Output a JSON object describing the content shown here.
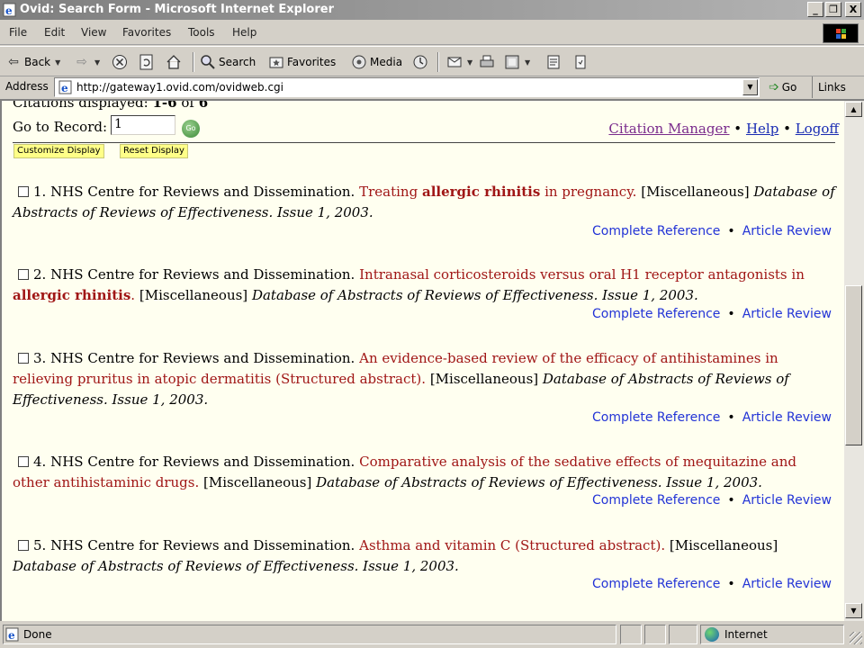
{
  "window": {
    "title": "Ovid: Search Form - Microsoft Internet Explorer",
    "controls": [
      "_",
      "❐",
      "X"
    ]
  },
  "menu": [
    "File",
    "Edit",
    "View",
    "Favorites",
    "Tools",
    "Help"
  ],
  "toolbar": {
    "back": "Back",
    "search": "Search",
    "favorites": "Favorites",
    "media": "Media"
  },
  "address": {
    "label": "Address",
    "url": "http://gateway1.ovid.com/ovidweb.cgi",
    "go": "Go",
    "links": "Links"
  },
  "page": {
    "citations_label": "Citations displayed:",
    "citations_range": "1-6",
    "citations_of": "of",
    "citations_total": "6",
    "goto_label": "Go to Record:",
    "goto_value": "1",
    "go_button": "Go",
    "citation_manager": "Citation Manager",
    "help": "Help",
    "logoff": "Logoff",
    "bullet": "•",
    "customize_display": "Customize Display",
    "reset_display": "Reset Display",
    "complete_reference": "Complete Reference",
    "article_review": "Article Review",
    "citations": [
      {
        "number": "1.",
        "author": "NHS Centre for Reviews and Dissemination.",
        "title_pre": "Treating",
        "title_bold": "allergic rhinitis",
        "title_post": "in pregnancy.",
        "type": "[Miscellaneous]",
        "source": "Database of Abstracts of Reviews of Effectiveness. Issue 1, 2003."
      },
      {
        "number": "2.",
        "author": "NHS Centre for Reviews and Dissemination.",
        "title_pre": "Intranasal corticosteroids versus oral H1 receptor antagonists in",
        "title_bold": "allergic rhinitis",
        "title_post": ".",
        "type": "[Miscellaneous]",
        "source": "Database of Abstracts of Reviews of Effectiveness. Issue 1, 2003."
      },
      {
        "number": "3.",
        "author": "NHS Centre for Reviews and Dissemination.",
        "title": "An evidence-based review of the efficacy of antihistamines in relieving pruritus in atopic dermatitis (Structured abstract).",
        "type": "[Miscellaneous]",
        "source": "Database of Abstracts of Reviews of Effectiveness. Issue 1, 2003."
      },
      {
        "number": "4.",
        "author": "NHS Centre for Reviews and Dissemination.",
        "title": "Comparative analysis of the sedative effects of mequitazine and other antihistaminic drugs.",
        "type": "[Miscellaneous]",
        "source": "Database of Abstracts of Reviews of Effectiveness. Issue 1, 2003."
      },
      {
        "number": "5.",
        "author": "NHS Centre for Reviews and Dissemination.",
        "title": "Asthma and vitamin C (Structured abstract).",
        "type": "[Miscellaneous]",
        "source": "Database of Abstracts of Reviews of Effectiveness. Issue 1, 2003."
      }
    ]
  },
  "status": {
    "text": "Done",
    "zone": "Internet"
  },
  "icons": [
    "ie-page-icon",
    "back-arrow-icon",
    "forward-arrow-icon",
    "stop-icon",
    "refresh-icon",
    "home-icon",
    "search-icon",
    "favorites-icon",
    "media-icon",
    "history-icon",
    "mail-icon",
    "print-icon",
    "edit-icon",
    "discuss-icon",
    "messenger-icon",
    "windows-logo-icon",
    "go-arrow-icon",
    "globe-icon"
  ],
  "colors": {
    "page_bg": "#fffff0",
    "title_red": "#a01616",
    "link_blue": "#2233d6",
    "visited_purple": "#7a2b8c",
    "button_yellow": "#ffff88"
  }
}
